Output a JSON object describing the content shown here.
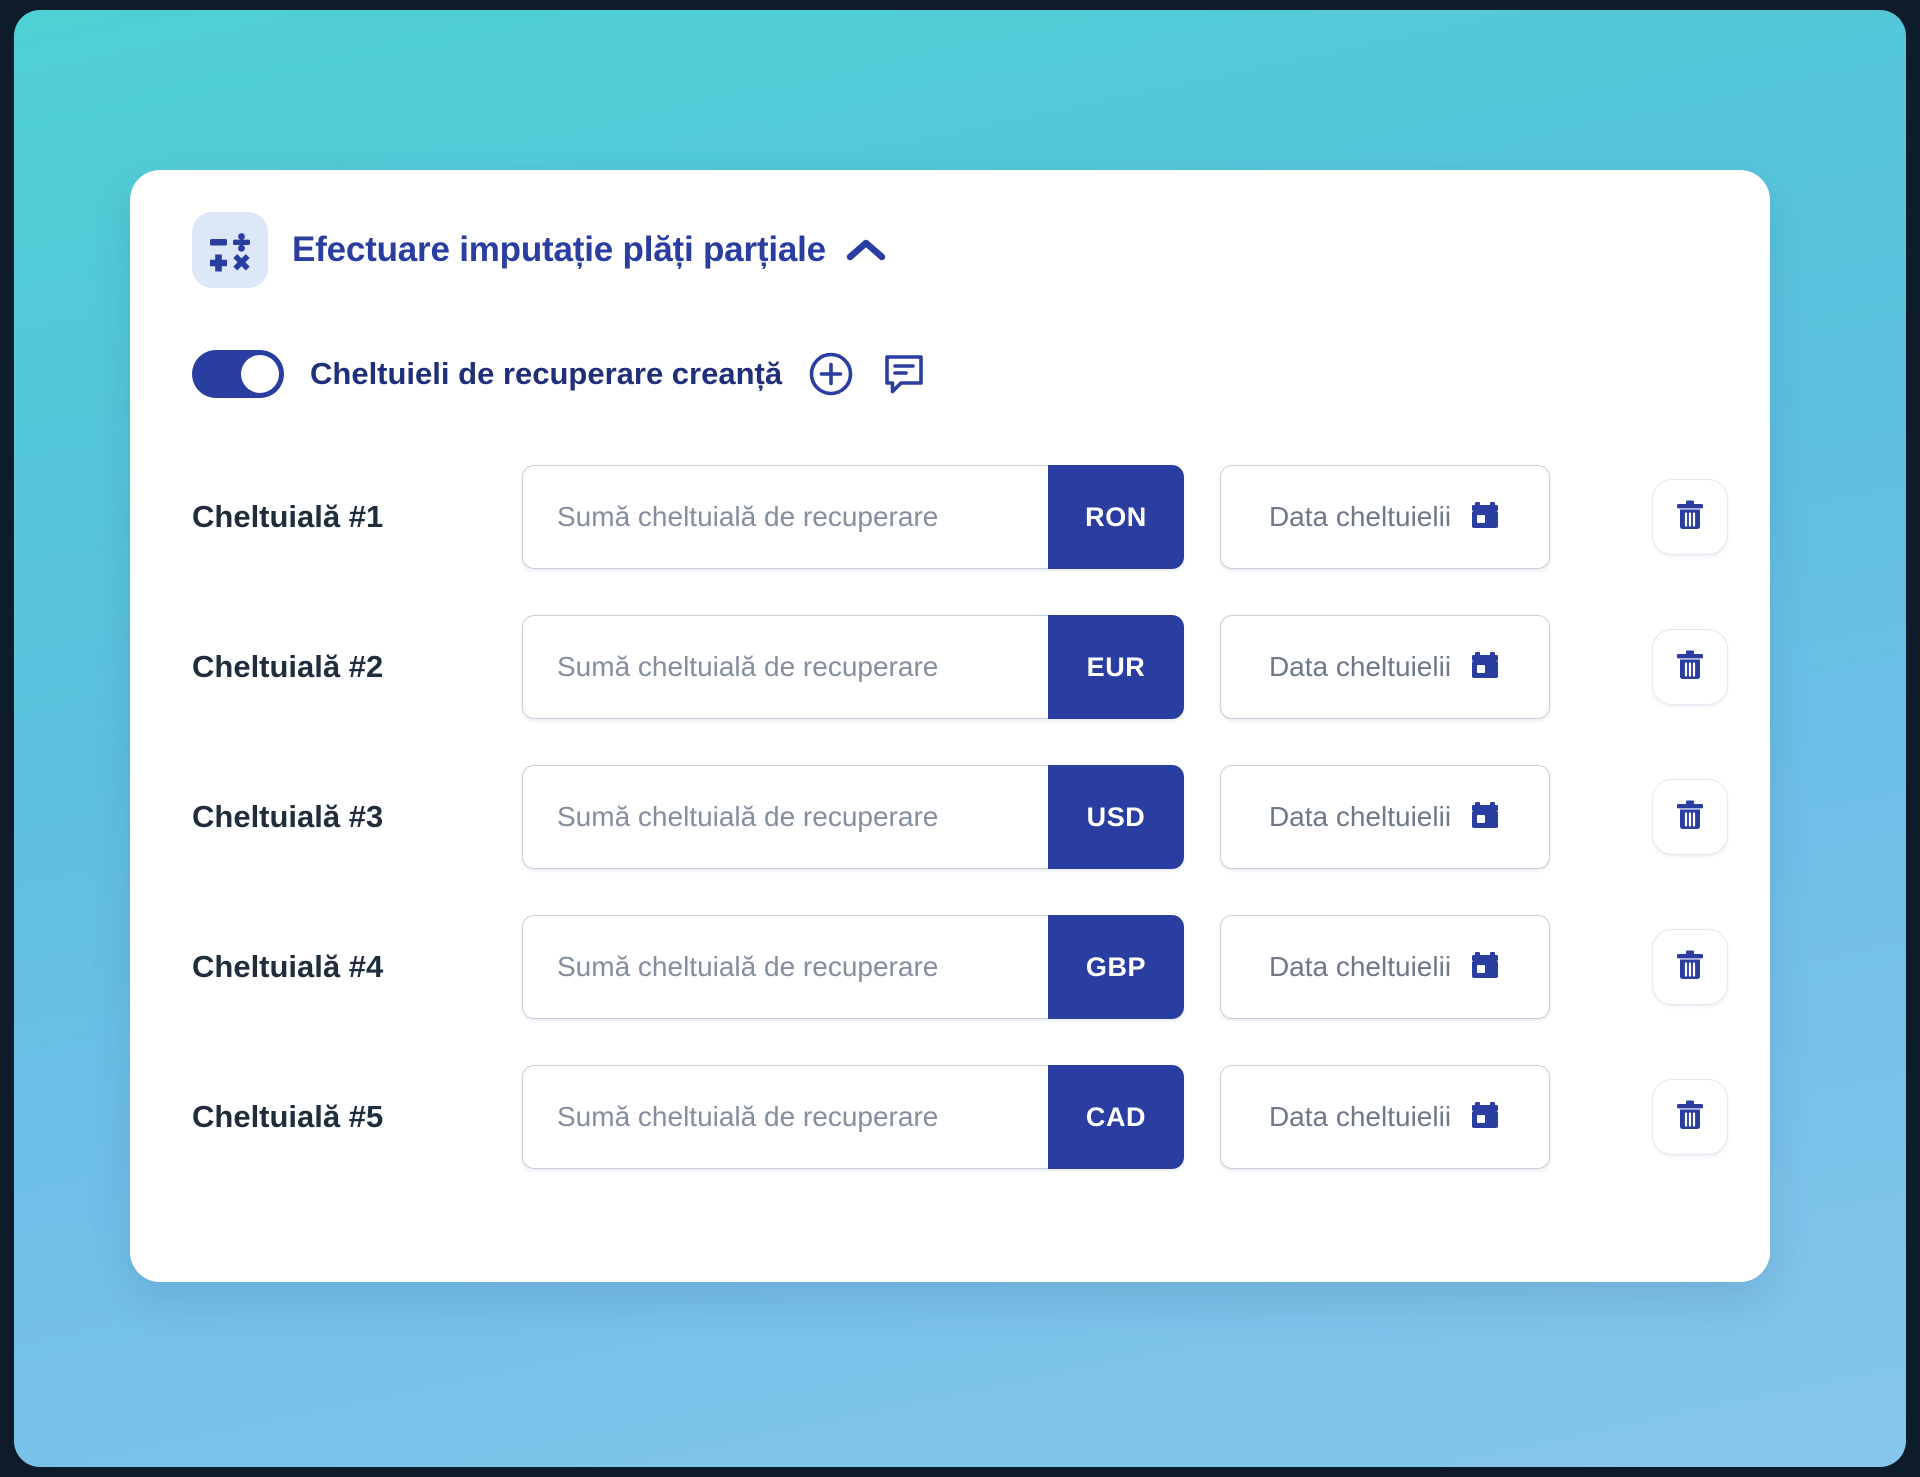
{
  "theme": {
    "brand_navy": "#2a3da0",
    "title_color": "#2a3da0",
    "label_color": "#1f2d3d",
    "placeholder_color": "#848e9e",
    "card_background": "#ffffff",
    "background_gradient_start": "#4fd0d3",
    "background_gradient_end": "#86c6ec",
    "icon_tile_background": "#dce8f7"
  },
  "header": {
    "icon": "calculator-operations-icon",
    "title": "Efectuare imputație plăți parțiale",
    "collapse_icon": "chevron-up-icon"
  },
  "section": {
    "toggle": {
      "state": "on",
      "label": "Cheltuieli de recuperare creanță"
    },
    "add_icon": "plus-circle-icon",
    "comment_icon": "comment-icon"
  },
  "table": {
    "amount_placeholder": "Sumă cheltuială de recuperare",
    "date_placeholder": "Data cheltuielii",
    "date_icon": "calendar-icon",
    "delete_icon": "trash-icon",
    "rows": [
      {
        "label": "Cheltuială #1",
        "amount": "",
        "currency": "RON",
        "date": ""
      },
      {
        "label": "Cheltuială #2",
        "amount": "",
        "currency": "EUR",
        "date": ""
      },
      {
        "label": "Cheltuială #3",
        "amount": "",
        "currency": "USD",
        "date": ""
      },
      {
        "label": "Cheltuială #4",
        "amount": "",
        "currency": "GBP",
        "date": ""
      },
      {
        "label": "Cheltuială #5",
        "amount": "",
        "currency": "CAD",
        "date": ""
      }
    ]
  }
}
